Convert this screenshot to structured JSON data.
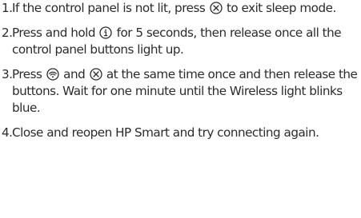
{
  "steps": [
    {
      "number": "1.",
      "parts": {
        "a": "If the control panel is not lit, press",
        "b": "to exit sleep mode."
      },
      "icons": [
        "cancel-icon"
      ]
    },
    {
      "number": "2.",
      "parts": {
        "a": "Press and hold",
        "b": "for 5 seconds, then release once all the control panel buttons light up."
      },
      "icons": [
        "information-icon"
      ]
    },
    {
      "number": "3.",
      "parts": {
        "a": "Press",
        "b": "and",
        "c": "at the same time once and then release the buttons. Wait for one minute until the Wireless light blinks blue."
      },
      "icons": [
        "wireless-icon",
        "cancel-icon"
      ]
    },
    {
      "number": "4.",
      "parts": {
        "a": "Close and reopen HP Smart and try connecting again."
      },
      "icons": []
    }
  ],
  "colors": {
    "text": "#2b2b2b"
  }
}
